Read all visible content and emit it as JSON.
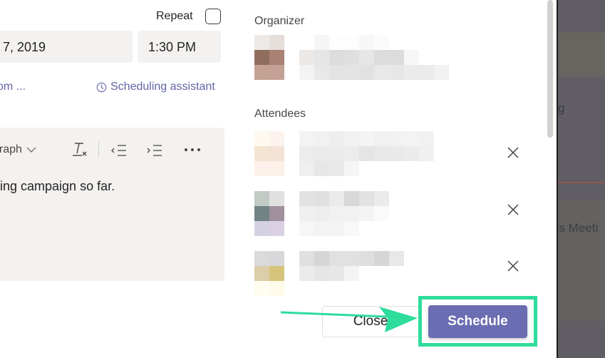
{
  "form": {
    "repeat_label": "Repeat",
    "repeat_checked": false,
    "date_value": "7, 2019",
    "time_value": "1:30 PM",
    "room_link": "om  ...",
    "scheduling_assistant": "Scheduling assistant",
    "accent": "#6264a7"
  },
  "editor": {
    "paragraph_label": "graph",
    "body_text": "ing campaign so far.",
    "toolbar_icons": [
      "clear-formatting-icon",
      "decrease-indent-icon",
      "increase-indent-icon",
      "more-options-icon"
    ]
  },
  "side_panel": {
    "organizer_label": "Organizer",
    "attendees_label": "Attendees",
    "organizer": {
      "avatar_rows": [
        [
          "#ede9e7",
          "#e6dedb"
        ],
        [
          "#8f6e5e",
          "#a98274"
        ],
        [
          "#c3a294",
          "#c3a194"
        ]
      ],
      "name_rows": [
        [
          "#ffffff",
          "#f5f5f5",
          "#fdfdfd",
          "#fdfdfd",
          "#f7f7f7",
          "#fbfbfb"
        ],
        [
          "#ece8e6",
          "#e6e6e6",
          "#dcdcdc",
          "#dfdfdf",
          "#e6e6e6",
          "#dcdcdc",
          "#dcdcdc",
          "#f7f7f7"
        ],
        [
          "#f3f3f3",
          "#e8e8e8",
          "#e3e3e3",
          "#e4e4e4",
          "#e1e1e1",
          "#e8e8e8",
          "#e7e7e7",
          "#ebebeb",
          "#ebebeb",
          "#f1f1f1"
        ]
      ]
    },
    "attendees": [
      {
        "avatar_rows": [
          [
            "#fff8ef",
            "#fcf3ee"
          ],
          [
            "#f5e4d2",
            "#f4e2d5"
          ],
          [
            "#fdf2eb",
            "#fbf1e8"
          ]
        ],
        "name_rows": [
          [
            "#f3f3f3",
            "#f1f1f1",
            "#eeeeee",
            "#f1f1f1",
            "#f4f4f4",
            "#f1f1f1",
            "#f2f2f2",
            "#f3f3f3",
            "#f1f1f1"
          ],
          [
            "#ececec",
            "#ebebeb",
            "#ebebeb",
            "#ececec",
            "#e5e5e5",
            "#e8e8e8",
            "#e9e9e9",
            "#ebebeb",
            "#f0f0f0"
          ],
          [
            "#efefef",
            "#e7e7e7",
            "#e9e9e9",
            "#f5f5f5"
          ]
        ],
        "remove_icon": "close-icon"
      },
      {
        "avatar_rows": [
          [
            "#c2cac5",
            "#e1e1e1"
          ],
          [
            "#728384",
            "#a08f9d"
          ],
          [
            "#d3d1e2",
            "#dad0e4"
          ]
        ],
        "name_rows": [
          [
            "#e2e2e2",
            "#e0e0e0",
            "#ebebeb",
            "#d8d8d8",
            "#e2e2e2",
            "#ebebeb"
          ],
          [
            "#f0f0f0",
            "#eeeeee",
            "#f1f1f1",
            "#f1f1f1",
            "#f4f4f4",
            "#fafafa"
          ],
          [
            "#f6f6f6",
            "#f3f3f3",
            "#f3f3f3",
            "#f8f8f8"
          ]
        ],
        "remove_icon": "close-icon"
      },
      {
        "avatar_rows": [
          [
            "#dadada",
            "#d8d8da"
          ],
          [
            "#dbcea9",
            "#d6c47c"
          ],
          [
            "#fffcf0",
            "#fffbea"
          ]
        ],
        "name_rows": [
          [
            "#e0e0e0",
            "#d5d5d5",
            "#e1e1e1",
            "#e1e1e1",
            "#dedede",
            "#d6d6d6",
            "#e8e8e8"
          ],
          [
            "#ebebeb",
            "#e5e5e5",
            "#e7e7e7",
            "#f3f3f3"
          ]
        ],
        "remove_icon": "close-icon"
      }
    ]
  },
  "footer": {
    "close_label": "Close",
    "schedule_label": "Schedule",
    "schedule_color": "#6a6db1",
    "annotation_color": "#2edc9c"
  },
  "background_app": {
    "text_1": "g",
    "text_2": "ns Meeti"
  }
}
